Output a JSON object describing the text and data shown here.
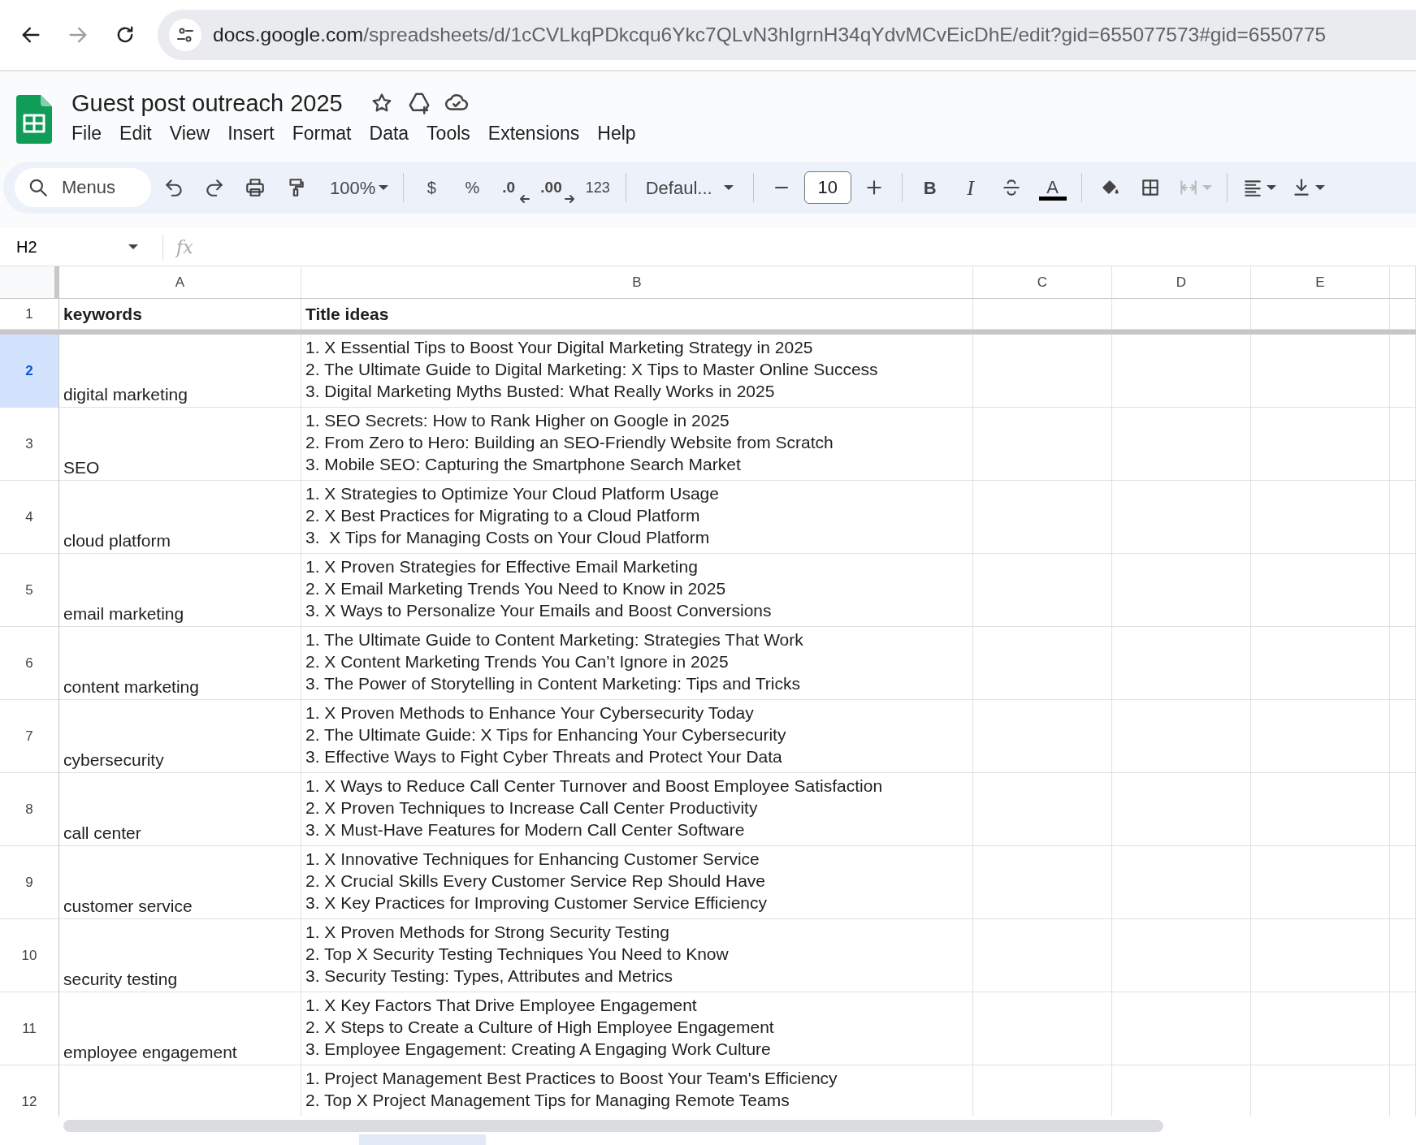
{
  "browser": {
    "url_host": "docs.google.com",
    "url_path": "/spreadsheets/d/1cCVLkqPDkcqu6Ykc7QLvN3hIgrnH34qYdvMCvEicDhE/edit?gid=655077573#gid=6550775"
  },
  "document": {
    "title": "Guest post outreach 2025"
  },
  "menu": [
    "File",
    "Edit",
    "View",
    "Insert",
    "Format",
    "Data",
    "Tools",
    "Extensions",
    "Help"
  ],
  "toolbar": {
    "search_placeholder": "Menus",
    "zoom": "100%",
    "currency": "$",
    "percent": "%",
    "decrease_decimal": ".0",
    "increase_decimal": ".00",
    "number_format": "123",
    "font": "Defaul...",
    "font_size": "10",
    "bold": "B",
    "italic": "I",
    "text_color": "A"
  },
  "formula_bar": {
    "cell_reference": "H2",
    "fx": "fx"
  },
  "columns": [
    {
      "label": "A",
      "selected": false
    },
    {
      "label": "B",
      "selected": false
    },
    {
      "label": "C",
      "selected": false
    },
    {
      "label": "D",
      "selected": false
    },
    {
      "label": "E",
      "selected": false
    }
  ],
  "rows": [
    {
      "number": "1",
      "selected": false,
      "kind": "header",
      "keyword": "keywords",
      "titles": [
        "Title ideas"
      ]
    },
    {
      "number": "2",
      "selected": true,
      "kind": "data",
      "keyword": "digital marketing",
      "titles": [
        "1. X Essential Tips to Boost Your Digital Marketing Strategy in 2025",
        "2. The Ultimate Guide to Digital Marketing: X Tips to Master Online Success",
        "3. Digital Marketing Myths Busted: What Really Works in 2025"
      ]
    },
    {
      "number": "3",
      "selected": false,
      "kind": "data",
      "keyword": "SEO",
      "titles": [
        "1. SEO Secrets: How to Rank Higher on Google in 2025",
        "2. From Zero to Hero: Building an SEO-Friendly Website from Scratch",
        "3. Mobile SEO: Capturing the Smartphone Search Market"
      ]
    },
    {
      "number": "4",
      "selected": false,
      "kind": "data",
      "keyword": "cloud platform",
      "titles": [
        "1. X Strategies to Optimize Your Cloud Platform Usage",
        "2. X Best Practices for Migrating to a Cloud Platform",
        "3.  X Tips for Managing Costs on Your Cloud Platform"
      ]
    },
    {
      "number": "5",
      "selected": false,
      "kind": "data",
      "keyword": "email marketing",
      "titles": [
        "1. X Proven Strategies for Effective Email Marketing",
        "2. X Email Marketing Trends You Need to Know in 2025",
        "3. X Ways to Personalize Your Emails and Boost Conversions"
      ]
    },
    {
      "number": "6",
      "selected": false,
      "kind": "data",
      "keyword": "content marketing",
      "titles": [
        "1. The Ultimate Guide to Content Marketing: Strategies That Work",
        "2. X Content Marketing Trends You Can’t Ignore in 2025",
        "3. The Power of Storytelling in Content Marketing: Tips and Tricks"
      ]
    },
    {
      "number": "7",
      "selected": false,
      "kind": "data",
      "keyword": "cybersecurity",
      "titles": [
        "1. X Proven Methods to Enhance Your Cybersecurity Today",
        "2. The Ultimate Guide: X Tips for Enhancing Your Cybersecurity",
        "3. Effective Ways to Fight Cyber Threats and Protect Your Data"
      ]
    },
    {
      "number": "8",
      "selected": false,
      "kind": "data",
      "keyword": "call center",
      "titles": [
        "1. X Ways to Reduce Call Center Turnover and Boost Employee Satisfaction",
        "2. X Proven Techniques to Increase Call Center Productivity",
        "3. X Must-Have Features for Modern Call Center Software"
      ]
    },
    {
      "number": "9",
      "selected": false,
      "kind": "data",
      "keyword": "customer service",
      "titles": [
        "1. X Innovative Techniques for Enhancing Customer Service",
        "2. X Crucial Skills Every Customer Service Rep Should Have",
        "3. X Key Practices for Improving Customer Service Efficiency"
      ]
    },
    {
      "number": "10",
      "selected": false,
      "kind": "data",
      "keyword": "security testing",
      "titles": [
        "1. X Proven Methods for Strong Security Testing",
        "2. Top X Security Testing Techniques You Need to Know",
        "3. Security Testing: Types, Attributes and Metrics"
      ]
    },
    {
      "number": "11",
      "selected": false,
      "kind": "data",
      "keyword": "employee engagement",
      "titles": [
        "1. X Key Factors That Drive Employee Engagement",
        "2. X Steps to Create a Culture of High Employee Engagement",
        "3. Employee Engagement: Creating A Engaging Work Culture"
      ]
    },
    {
      "number": "12",
      "selected": false,
      "kind": "data",
      "keyword": "",
      "titles": [
        "1. Project Management Best Practices to Boost Your Team's Efficiency",
        "2. Top X Project Management Tips for Managing Remote Teams"
      ]
    }
  ]
}
